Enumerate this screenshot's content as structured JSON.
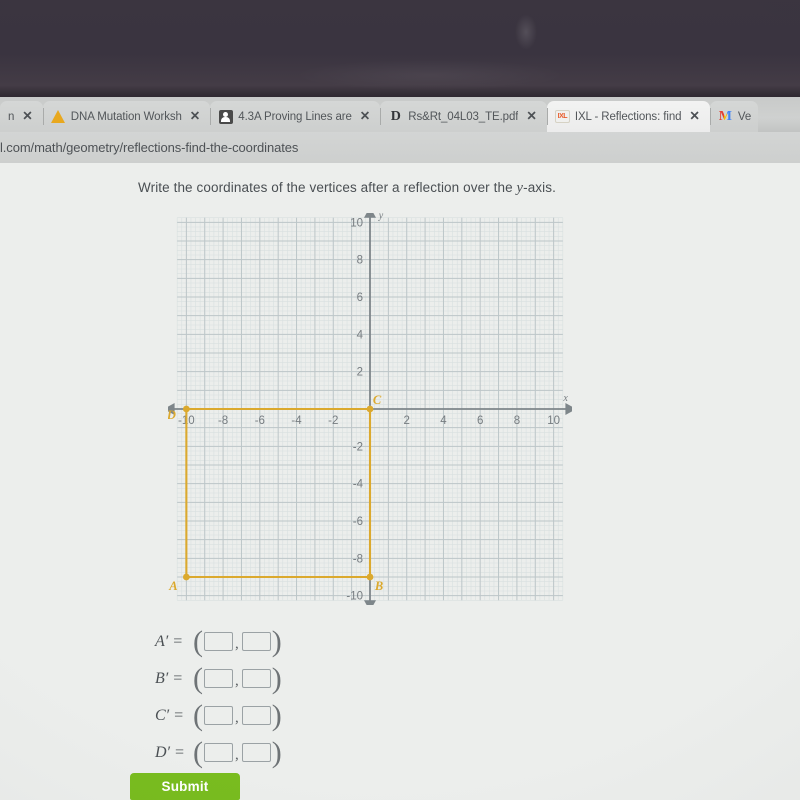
{
  "browser": {
    "tabs": [
      {
        "favicon": "generic-page-icon",
        "title": "n",
        "close_label": "✕",
        "active": false
      },
      {
        "favicon": "warning-triangle-icon",
        "title": "DNA Mutation Worksh",
        "close_label": "✕",
        "active": false
      },
      {
        "favicon": "contact-card-icon",
        "title": "4.3A Proving Lines are",
        "close_label": "✕",
        "active": false
      },
      {
        "favicon": "pdf-document-icon",
        "title": "Rs&Rt_04L03_TE.pdf",
        "close_label": "✕",
        "active": false
      },
      {
        "favicon": "ixl-logo-icon",
        "title": "IXL - Reflections: find",
        "close_label": "✕",
        "active": true
      },
      {
        "favicon": "gmail-icon",
        "title": "Ve",
        "close_label": "",
        "active": false
      }
    ],
    "url": "l.com/math/geometry/reflections-find-the-coordinates"
  },
  "page": {
    "question_before": "Write the coordinates of the vertices after a reflection over the ",
    "question_italic": "y",
    "question_after": "-axis.",
    "submit_label": "Submit"
  },
  "answers": {
    "rows": [
      {
        "label": "A′ =",
        "x_value": "",
        "y_value": "",
        "placeholder": ""
      },
      {
        "label": "B′ =",
        "x_value": "",
        "y_value": "",
        "placeholder": ""
      },
      {
        "label": "C′ =",
        "x_value": "",
        "y_value": "",
        "placeholder": ""
      },
      {
        "label": "D′ =",
        "x_value": "",
        "y_value": "",
        "placeholder": ""
      }
    ],
    "open_paren": "(",
    "close_paren": ")",
    "comma": ","
  },
  "chart_data": {
    "type": "scatter",
    "title": "",
    "xlabel": "x",
    "ylabel": "y",
    "xlim": [
      -11,
      11
    ],
    "ylim": [
      -10.5,
      10.5
    ],
    "xticks": [
      -10,
      -8,
      -6,
      -4,
      -2,
      2,
      4,
      6,
      8,
      10
    ],
    "xtick_labels": [
      "-10",
      "-8",
      "-6",
      "-4",
      "-2",
      "2",
      "4",
      "6",
      "8",
      "10"
    ],
    "yticks": [
      10,
      8,
      6,
      4,
      2,
      -2,
      -4,
      -6,
      -8,
      -10
    ],
    "ytick_labels": [
      "10",
      "8",
      "6",
      "4",
      "2",
      "-2",
      "-4",
      "-6",
      "-8",
      "-10"
    ],
    "grid": true,
    "minor_grid": true,
    "minor_step": 0.25,
    "major_step": 1,
    "grid_color": "#bcc6c8",
    "axis_color": "#7e868a",
    "shape_color": "#dba92e",
    "shape_label": "rectangle-ABCD",
    "points": [
      {
        "name": "A",
        "x": -10,
        "y": -9,
        "label_dx": -13,
        "label_dy": 13
      },
      {
        "name": "B",
        "x": 0,
        "y": -9,
        "label_dx": 9,
        "label_dy": 13
      },
      {
        "name": "C",
        "x": 0,
        "y": 0,
        "label_dx": 7,
        "label_dy": -5
      },
      {
        "name": "D",
        "x": -10,
        "y": 0,
        "label_dx": -15,
        "label_dy": 10
      }
    ],
    "polygon": [
      [
        -10,
        0
      ],
      [
        0,
        0
      ],
      [
        0,
        -9
      ],
      [
        -10,
        -9
      ]
    ]
  }
}
